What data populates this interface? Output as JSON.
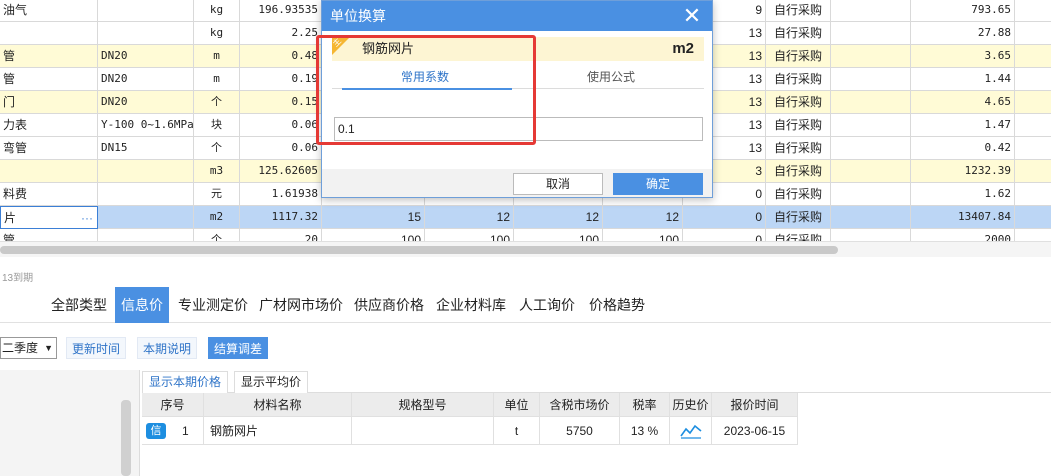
{
  "grid": {
    "rows": [
      {
        "style": "white",
        "c0": "油气",
        "c1": "",
        "c2": "kg",
        "c3": "196.93535",
        "c8": "9",
        "c9": "自行采购",
        "c11": "793.65"
      },
      {
        "style": "white",
        "c0": "",
        "c1": "",
        "c2": "kg",
        "c3": "2.25",
        "c8": "13",
        "c9": "自行采购",
        "c11": "27.88"
      },
      {
        "style": "yellow",
        "c0": "管",
        "c1": "DN20",
        "c2": "m",
        "c3": "0.48",
        "c8": "13",
        "c9": "自行采购",
        "c11": "3.65"
      },
      {
        "style": "white",
        "c0": "管",
        "c1": "DN20",
        "c2": "m",
        "c3": "0.19",
        "c8": "13",
        "c9": "自行采购",
        "c11": "1.44"
      },
      {
        "style": "yellow",
        "c0": "门",
        "c1": "DN20",
        "c2": "个",
        "c3": "0.15",
        "c8": "13",
        "c9": "自行采购",
        "c11": "4.65"
      },
      {
        "style": "white",
        "c0": "力表",
        "c1": "Y-100 0~1.6MPa",
        "c2": "块",
        "c3": "0.06",
        "c8": "13",
        "c9": "自行采购",
        "c11": "1.47"
      },
      {
        "style": "white",
        "c0": "弯管",
        "c1": "DN15",
        "c2": "个",
        "c3": "0.06",
        "c8": "13",
        "c9": "自行采购",
        "c11": "0.42"
      },
      {
        "style": "yellow",
        "c0": "",
        "c1": "",
        "c2": "m3",
        "c3": "125.62605",
        "c8": "3",
        "c9": "自行采购",
        "c11": "1232.39"
      },
      {
        "style": "white",
        "c0": "料费",
        "c1": "",
        "c2": "元",
        "c3": "1.61938",
        "c8": "0",
        "c9": "自行采购",
        "c11": "1.62"
      },
      {
        "style": "selected",
        "c0": "片",
        "c1": "",
        "c2": "m2",
        "c3": "1117.32",
        "c4": "15",
        "c5": "12",
        "c6": "12",
        "c7": "12",
        "c8": "0",
        "c9": "自行采购",
        "c11": "13407.84"
      },
      {
        "style": "white",
        "c0": "管",
        "c1": "",
        "c2": "个",
        "c3": "20",
        "c4": "100",
        "c5": "100",
        "c6": "100",
        "c7": "100",
        "c8": "0",
        "c9": "自行采购",
        "c11": "2000"
      }
    ],
    "ellipsis": "···"
  },
  "bottom": {
    "expiry_note": "13到期",
    "tabs": [
      "全部类型",
      "信息价",
      "专业测定价",
      "广材网市场价",
      "供应商价格",
      "企业材料库",
      "人工询价",
      "价格趋势"
    ],
    "active_tab": "信息价",
    "quarter": "二季度",
    "toolbar": {
      "update_time": "更新时间",
      "period_note": "本期说明",
      "settlement": "结算调差"
    },
    "subtabs": {
      "current": "显示本期价格",
      "average": "显示平均价"
    },
    "table": {
      "headers": [
        "序号",
        "材料名称",
        "规格型号",
        "单位",
        "含税市场价",
        "税率",
        "历史价",
        "报价时间"
      ],
      "rows": [
        {
          "badge": "信",
          "index": "1",
          "name": "钢筋网片",
          "spec": "",
          "unit": "t",
          "price": "5750",
          "tax": "13 %",
          "date": "2023-06-15"
        }
      ]
    }
  },
  "dialog": {
    "title": "单位换算",
    "material_name": "钢筋网片",
    "material_unit": "m2",
    "corner_tag": "主",
    "tabs": {
      "common": "常用系数",
      "formula": "使用公式"
    },
    "factor_value": "0.1",
    "cancel": "取消",
    "ok": "确定"
  },
  "colors": {
    "accent": "#4a90e2",
    "highlight": "#e53935",
    "row_yellow": "#fffbd6",
    "row_selected": "#bcd6f5"
  }
}
